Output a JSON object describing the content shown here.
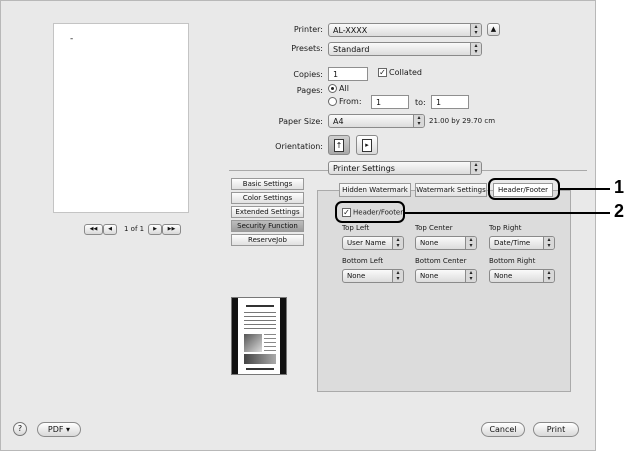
{
  "printer": {
    "label": "Printer:",
    "value": "AL-XXXX"
  },
  "presets": {
    "label": "Presets:",
    "value": "Standard"
  },
  "copies": {
    "label": "Copies:",
    "value": "1",
    "collated_label": "Collated",
    "collated_checked": true
  },
  "pages": {
    "label": "Pages:",
    "all_label": "All",
    "from_label": "From:",
    "from_value": "1",
    "to_label": "to:",
    "to_value": "1"
  },
  "paper_size": {
    "label": "Paper Size:",
    "value": "A4",
    "dimensions": "21.00 by 29.70 cm"
  },
  "orientation": {
    "label": "Orientation:"
  },
  "section_menu": {
    "value": "Printer Settings"
  },
  "preview": {
    "dash": "-",
    "page_indicator": "1 of 1",
    "first_label": "◀◀",
    "prev_label": "◀",
    "next_label": "▶",
    "last_label": "▶▶"
  },
  "side_buttons": [
    {
      "label": "Basic Settings",
      "active": false
    },
    {
      "label": "Color Settings",
      "active": false
    },
    {
      "label": "Extended Settings",
      "active": false
    },
    {
      "label": "Security Function",
      "active": true
    },
    {
      "label": "ReserveJob",
      "active": false
    }
  ],
  "tabs": [
    {
      "label": "Hidden Watermark",
      "selected": false
    },
    {
      "label": "Watermark Settings",
      "selected": false
    },
    {
      "label": "Header/Footer",
      "selected": true
    }
  ],
  "header_footer": {
    "checkbox_label": "Header/Footer",
    "checked": true,
    "top_left": {
      "label": "Top Left",
      "value": "User Name"
    },
    "top_center": {
      "label": "Top Center",
      "value": "None"
    },
    "top_right": {
      "label": "Top Right",
      "value": "Date/Time"
    },
    "bottom_left": {
      "label": "Bottom Left",
      "value": "None"
    },
    "bottom_center": {
      "label": "Bottom Center",
      "value": "None"
    },
    "bottom_right": {
      "label": "Bottom Right",
      "value": "None"
    }
  },
  "footer": {
    "help": "?",
    "pdf": "PDF ▾",
    "cancel": "Cancel",
    "print": "Print"
  },
  "callouts": [
    "1",
    "2"
  ]
}
